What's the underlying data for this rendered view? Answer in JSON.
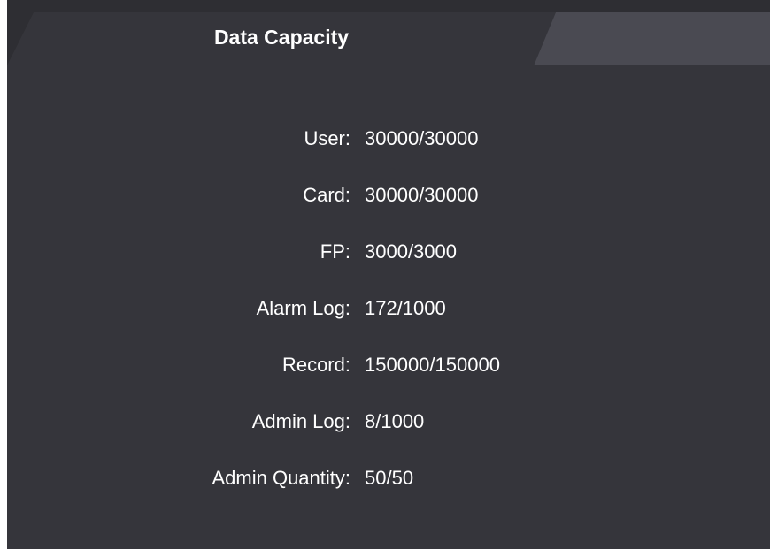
{
  "panel": {
    "title": "Data Capacity"
  },
  "capacity": [
    {
      "label": "User:",
      "value": "30000/30000"
    },
    {
      "label": "Card:",
      "value": "30000/30000"
    },
    {
      "label": "FP:",
      "value": "3000/3000"
    },
    {
      "label": "Alarm Log:",
      "value": "172/1000"
    },
    {
      "label": "Record:",
      "value": "150000/150000"
    },
    {
      "label": "Admin Log:",
      "value": "8/1000"
    },
    {
      "label": "Admin Quantity:",
      "value": "50/50"
    }
  ],
  "colors": {
    "panel_bg": "#35353b",
    "tab_bar_bg": "#2e2e33",
    "tab_deco": "#4a4a52",
    "text": "#ffffff"
  }
}
